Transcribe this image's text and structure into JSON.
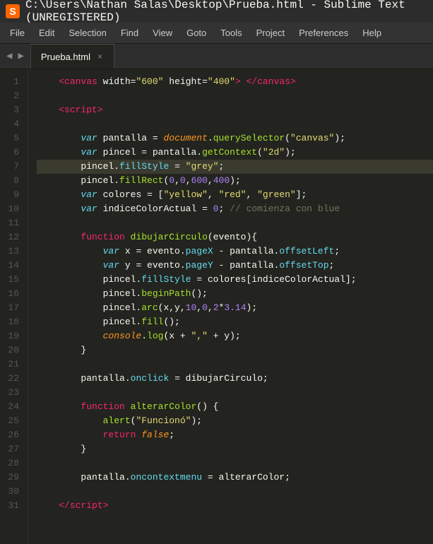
{
  "titlebar": {
    "icon": "S",
    "text": "C:\\Users\\Nathan Salas\\Desktop\\Prueba.html - Sublime Text (UNREGISTERED)"
  },
  "menubar": {
    "items": [
      "File",
      "Edit",
      "Selection",
      "Find",
      "View",
      "Goto",
      "Tools",
      "Project",
      "Preferences",
      "Help"
    ]
  },
  "tab": {
    "label": "Prueba.html",
    "close": "×"
  },
  "nav": {
    "left": "◀",
    "right": "▶"
  },
  "lines": {
    "count": 31
  }
}
